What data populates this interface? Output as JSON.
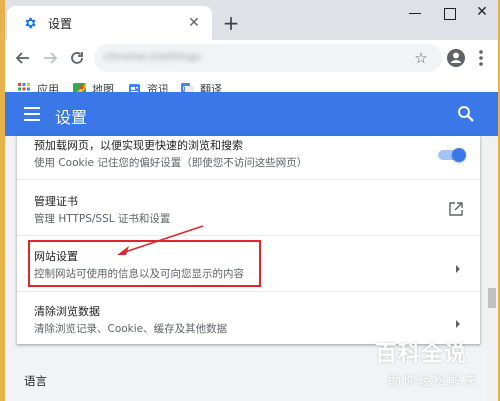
{
  "browser": {
    "tab_title": "设置",
    "tab_close": "✕",
    "new_tab": "+",
    "address_blurred": "chrome://settings",
    "bookmarks": [
      {
        "label": "应用",
        "icon": "apps-grid-icon"
      },
      {
        "label": "地图",
        "icon": "maps-icon"
      },
      {
        "label": "资讯",
        "icon": "news-icon"
      },
      {
        "label": "翻译",
        "icon": "translate-icon"
      }
    ]
  },
  "settings": {
    "header_title": "设置",
    "rows": [
      {
        "title": "预加载网页，以便实现更快速的浏览和搜索",
        "subtitle": "使用 Cookie 记住您的偏好设置（即使您不访问这些网页）",
        "control": "toggle",
        "toggle_on": true
      },
      {
        "title": "管理证书",
        "subtitle": "管理 HTTPS/SSL 证书和设置",
        "control": "open-in-new-icon"
      },
      {
        "title": "网站设置",
        "subtitle": "控制网站可使用的信息以及可向您显示的内容",
        "control": "chevron-right-icon",
        "highlighted": true
      },
      {
        "title": "清除浏览数据",
        "subtitle": "清除浏览记录、Cookie、缓存及其他数据",
        "control": "chevron-right-icon"
      }
    ],
    "next_section_title": "语言"
  },
  "watermark": {
    "main": "百科全说",
    "sub": "助你轻松解决"
  },
  "colors": {
    "header_blue": "#3b78e7",
    "highlight_red": "#e0262c",
    "toggle_blue": "#3b78e7",
    "frame_orange": "#e8b24a"
  }
}
